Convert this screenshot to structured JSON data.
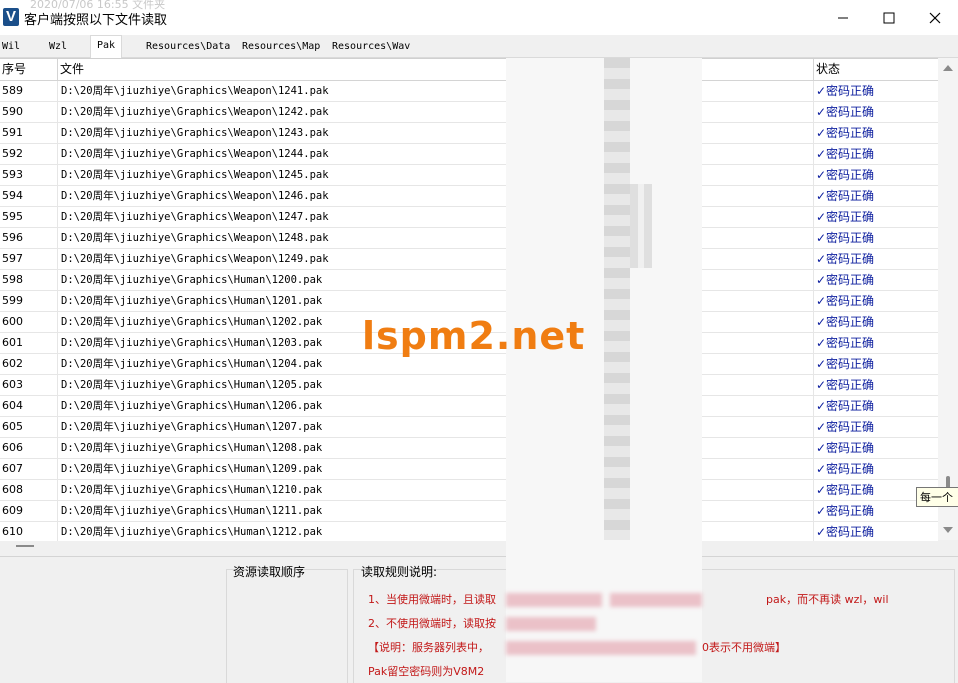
{
  "window": {
    "title": "客户端按照以下文件读取",
    "faded_title": "2020/07/06 16:55    文件夹"
  },
  "tabs": [
    "Wil",
    "Wzl",
    "Pak",
    "Resources\\Data",
    "Resources\\Map",
    "Resources\\Wav"
  ],
  "active_tab": "Pak",
  "table": {
    "headers": {
      "seq": "序号",
      "file": "文件",
      "status": "状态"
    },
    "rows": [
      {
        "seq": "589",
        "file": "D:\\20周年\\jiuzhiye\\Graphics\\Weapon\\1241.pak",
        "status": "✓密码正确"
      },
      {
        "seq": "590",
        "file": "D:\\20周年\\jiuzhiye\\Graphics\\Weapon\\1242.pak",
        "status": "✓密码正确"
      },
      {
        "seq": "591",
        "file": "D:\\20周年\\jiuzhiye\\Graphics\\Weapon\\1243.pak",
        "status": "✓密码正确"
      },
      {
        "seq": "592",
        "file": "D:\\20周年\\jiuzhiye\\Graphics\\Weapon\\1244.pak",
        "status": "✓密码正确"
      },
      {
        "seq": "593",
        "file": "D:\\20周年\\jiuzhiye\\Graphics\\Weapon\\1245.pak",
        "status": "✓密码正确"
      },
      {
        "seq": "594",
        "file": "D:\\20周年\\jiuzhiye\\Graphics\\Weapon\\1246.pak",
        "status": "✓密码正确"
      },
      {
        "seq": "595",
        "file": "D:\\20周年\\jiuzhiye\\Graphics\\Weapon\\1247.pak",
        "status": "✓密码正确"
      },
      {
        "seq": "596",
        "file": "D:\\20周年\\jiuzhiye\\Graphics\\Weapon\\1248.pak",
        "status": "✓密码正确"
      },
      {
        "seq": "597",
        "file": "D:\\20周年\\jiuzhiye\\Graphics\\Weapon\\1249.pak",
        "status": "✓密码正确"
      },
      {
        "seq": "598",
        "file": "D:\\20周年\\jiuzhiye\\Graphics\\Human\\1200.pak",
        "status": "✓密码正确"
      },
      {
        "seq": "599",
        "file": "D:\\20周年\\jiuzhiye\\Graphics\\Human\\1201.pak",
        "status": "✓密码正确"
      },
      {
        "seq": "600",
        "file": "D:\\20周年\\jiuzhiye\\Graphics\\Human\\1202.pak",
        "status": "✓密码正确"
      },
      {
        "seq": "601",
        "file": "D:\\20周年\\jiuzhiye\\Graphics\\Human\\1203.pak",
        "status": "✓密码正确"
      },
      {
        "seq": "602",
        "file": "D:\\20周年\\jiuzhiye\\Graphics\\Human\\1204.pak",
        "status": "✓密码正确"
      },
      {
        "seq": "603",
        "file": "D:\\20周年\\jiuzhiye\\Graphics\\Human\\1205.pak",
        "status": "✓密码正确"
      },
      {
        "seq": "604",
        "file": "D:\\20周年\\jiuzhiye\\Graphics\\Human\\1206.pak",
        "status": "✓密码正确"
      },
      {
        "seq": "605",
        "file": "D:\\20周年\\jiuzhiye\\Graphics\\Human\\1207.pak",
        "status": "✓密码正确"
      },
      {
        "seq": "606",
        "file": "D:\\20周年\\jiuzhiye\\Graphics\\Human\\1208.pak",
        "status": "✓密码正确"
      },
      {
        "seq": "607",
        "file": "D:\\20周年\\jiuzhiye\\Graphics\\Human\\1209.pak",
        "status": "✓密码正确"
      },
      {
        "seq": "608",
        "file": "D:\\20周年\\jiuzhiye\\Graphics\\Human\\1210.pak",
        "status": "✓密码正确"
      },
      {
        "seq": "609",
        "file": "D:\\20周年\\jiuzhiye\\Graphics\\Human\\1211.pak",
        "status": "✓密码正确"
      },
      {
        "seq": "610",
        "file": "D:\\20周年\\jiuzhiye\\Graphics\\Human\\1212.pak",
        "status": "✓密码正确"
      }
    ]
  },
  "tooltip": "每一个",
  "watermark": "lspm2.net",
  "bottom": {
    "resource_order_label": "资源读取顺序",
    "rules_label": "读取规则说明:",
    "rules": [
      {
        "pre": "1、当使用微端时，且读取",
        "post": "pak，而不再读 wzl，wil"
      },
      {
        "pre": "2、不使用微端时，读取按",
        "post": ""
      },
      {
        "pre": "【说明：服务器列表中，",
        "post": "为0表示不用微端】"
      },
      {
        "pre": "Pak留空密码则为V8M2",
        "post": ""
      }
    ]
  },
  "colors": {
    "status_blue": "#0b1d9e",
    "rule_red": "#c21818",
    "watermark_orange": "#f07d12"
  }
}
